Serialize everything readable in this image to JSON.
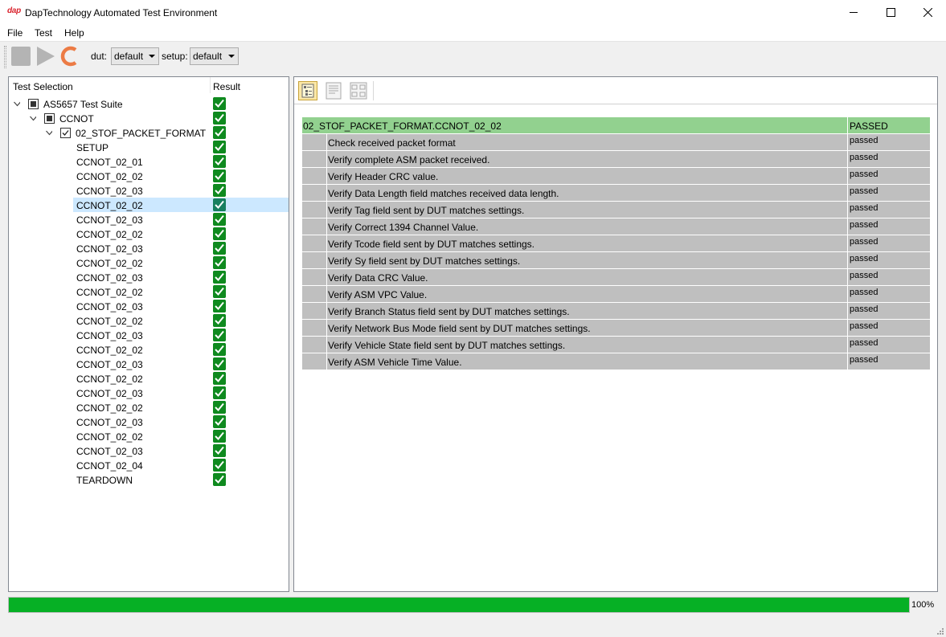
{
  "window": {
    "logo": "dap",
    "title": "DapTechnology Automated Test Environment"
  },
  "menu": {
    "items": [
      "File",
      "Test",
      "Help"
    ]
  },
  "toolbar": {
    "dut_label": "dut:",
    "dut_value": "default",
    "setup_label": "setup:",
    "setup_value": "default"
  },
  "tree": {
    "header_selection": "Test Selection",
    "header_result": "Result",
    "rows": [
      {
        "label": "AS5657 Test Suite",
        "level": 0,
        "expander": "open",
        "check": "partial",
        "result": "pass"
      },
      {
        "label": "CCNOT",
        "level": 1,
        "expander": "open",
        "check": "partial",
        "result": "pass"
      },
      {
        "label": "02_STOF_PACKET_FORMAT",
        "level": 2,
        "expander": "open",
        "check": "checked",
        "result": "pass"
      },
      {
        "label": "SETUP",
        "level": 3,
        "result": "pass"
      },
      {
        "label": "CCNOT_02_01",
        "level": 3,
        "result": "pass"
      },
      {
        "label": "CCNOT_02_02",
        "level": 3,
        "result": "pass"
      },
      {
        "label": "CCNOT_02_03",
        "level": 3,
        "result": "pass"
      },
      {
        "label": "CCNOT_02_02",
        "level": 3,
        "result": "pass",
        "selected": true
      },
      {
        "label": "CCNOT_02_03",
        "level": 3,
        "result": "pass"
      },
      {
        "label": "CCNOT_02_02",
        "level": 3,
        "result": "pass"
      },
      {
        "label": "CCNOT_02_03",
        "level": 3,
        "result": "pass"
      },
      {
        "label": "CCNOT_02_02",
        "level": 3,
        "result": "pass"
      },
      {
        "label": "CCNOT_02_03",
        "level": 3,
        "result": "pass"
      },
      {
        "label": "CCNOT_02_02",
        "level": 3,
        "result": "pass"
      },
      {
        "label": "CCNOT_02_03",
        "level": 3,
        "result": "pass"
      },
      {
        "label": "CCNOT_02_02",
        "level": 3,
        "result": "pass"
      },
      {
        "label": "CCNOT_02_03",
        "level": 3,
        "result": "pass"
      },
      {
        "label": "CCNOT_02_02",
        "level": 3,
        "result": "pass"
      },
      {
        "label": "CCNOT_02_03",
        "level": 3,
        "result": "pass"
      },
      {
        "label": "CCNOT_02_02",
        "level": 3,
        "result": "pass"
      },
      {
        "label": "CCNOT_02_03",
        "level": 3,
        "result": "pass"
      },
      {
        "label": "CCNOT_02_02",
        "level": 3,
        "result": "pass"
      },
      {
        "label": "CCNOT_02_03",
        "level": 3,
        "result": "pass"
      },
      {
        "label": "CCNOT_02_02",
        "level": 3,
        "result": "pass"
      },
      {
        "label": "CCNOT_02_03",
        "level": 3,
        "result": "pass"
      },
      {
        "label": "CCNOT_02_04",
        "level": 3,
        "result": "pass"
      },
      {
        "label": "TEARDOWN",
        "level": 3,
        "result": "pass"
      }
    ]
  },
  "results": {
    "header_name": "02_STOF_PACKET_FORMAT.CCNOT_02_02",
    "header_status": "PASSED",
    "header_color": "#92d18f",
    "row_color": "#bfbfbf",
    "rows": [
      {
        "name": "Check received packet format",
        "status": "passed"
      },
      {
        "name": "Verify complete ASM packet received.",
        "status": "passed"
      },
      {
        "name": "Verify Header CRC value.",
        "status": "passed"
      },
      {
        "name": "Verify Data Length field matches received data length.",
        "status": "passed"
      },
      {
        "name": "Verify Tag field sent by DUT matches settings.",
        "status": "passed"
      },
      {
        "name": "Verify Correct 1394 Channel Value.",
        "status": "passed"
      },
      {
        "name": "Verify Tcode field sent by DUT matches settings.",
        "status": "passed"
      },
      {
        "name": "Verify Sy field sent by DUT matches settings.",
        "status": "passed"
      },
      {
        "name": "Verify Data CRC Value.",
        "status": "passed"
      },
      {
        "name": "Verify ASM VPC Value.",
        "status": "passed"
      },
      {
        "name": "Verify Branch Status field sent by DUT matches settings.",
        "status": "passed"
      },
      {
        "name": "Verify Network Bus Mode field sent by DUT matches settings.",
        "status": "passed"
      },
      {
        "name": "Verify Vehicle State field sent by DUT matches settings.",
        "status": "passed"
      },
      {
        "name": "Verify ASM Vehicle Time Value.",
        "status": "passed"
      }
    ]
  },
  "progress": {
    "percent": 100,
    "label": "100%",
    "color": "#06b025"
  },
  "icons": {
    "stop": "stop-icon",
    "run": "play-icon",
    "reload": "reload-icon",
    "result_pass": "check-icon",
    "view_tree": "tree-view-icon",
    "view_log": "log-view-icon",
    "view_diff": "compare-view-icon"
  }
}
